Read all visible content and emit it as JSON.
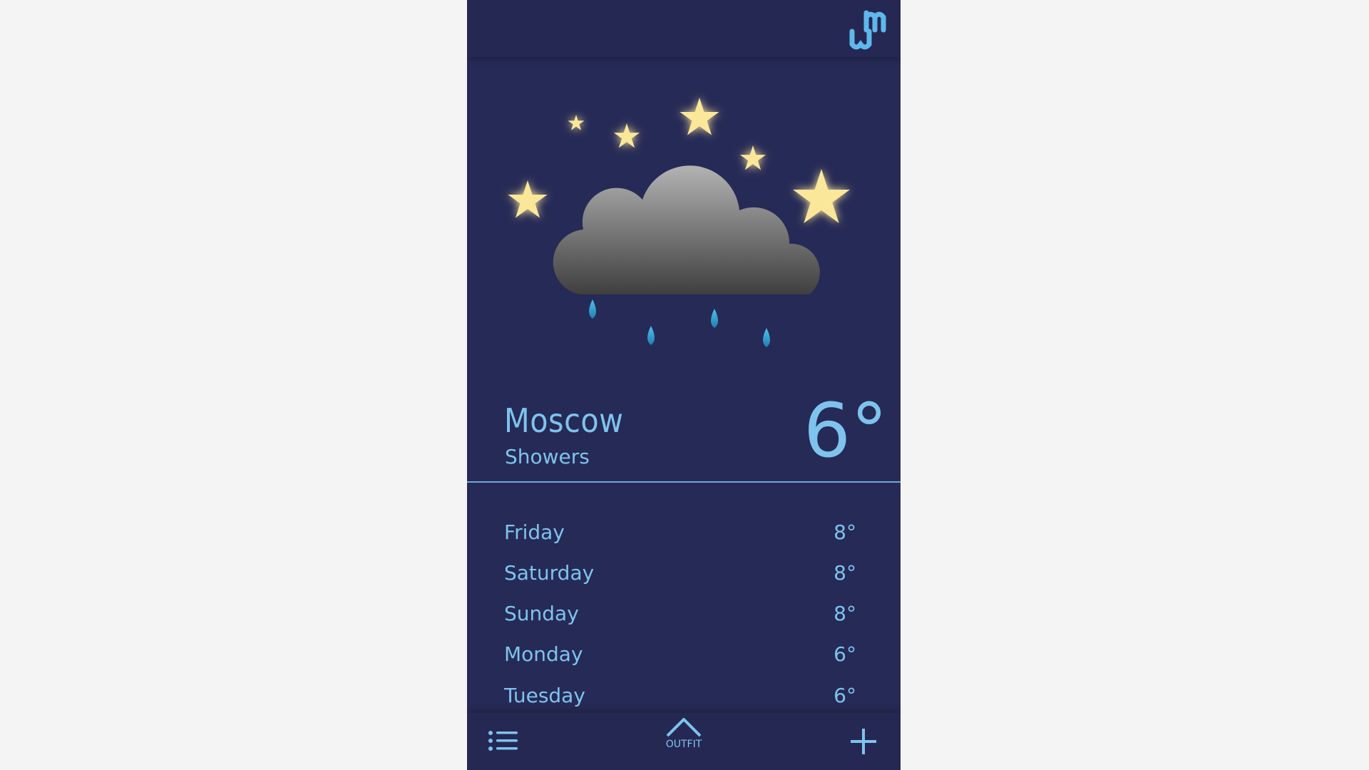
{
  "app": {
    "logo_icon": "wm-logo-icon"
  },
  "current": {
    "city": "Moscow",
    "condition": "Showers",
    "temperature": "6°",
    "art_icon": "night-rain-cloud-icon"
  },
  "forecast": [
    {
      "day": "Friday",
      "temp": "8°"
    },
    {
      "day": "Saturday",
      "temp": "8°"
    },
    {
      "day": "Sunday",
      "temp": "8°"
    },
    {
      "day": "Monday",
      "temp": "6°"
    },
    {
      "day": "Tuesday",
      "temp": "6°"
    }
  ],
  "bottom_nav": {
    "menu_icon": "list-icon",
    "outfit_label": "OUTFIT",
    "outfit_icon": "chevron-up-icon",
    "add_icon": "plus-icon"
  },
  "colors": {
    "background": "#262a56",
    "accent": "#7ec3ee",
    "star": "#fbe79a",
    "raindrop": "#38a6d6"
  }
}
